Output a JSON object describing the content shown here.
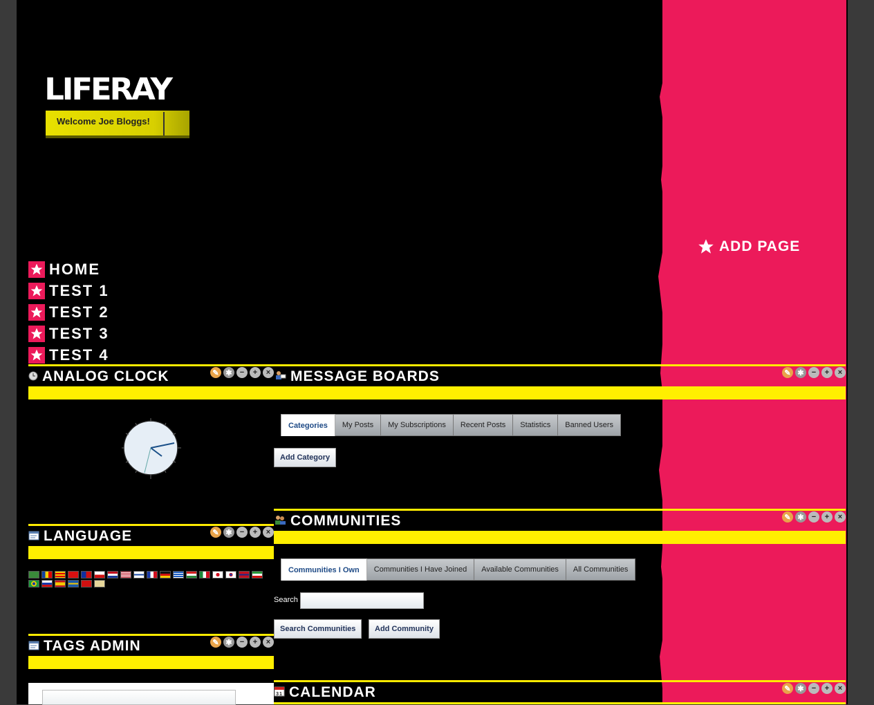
{
  "header": {
    "logo_text": "LIFERAY",
    "welcome_text": "Welcome Joe Bloggs!",
    "add_page_label": "ADD PAGE"
  },
  "colors": {
    "background": "#000000",
    "accent_pink": "#ec1a5a",
    "accent_yellow": "#ffef00",
    "outer_frame": "#3a3a3a"
  },
  "navigation": {
    "items": [
      {
        "label": "HOME",
        "icon": "star-icon"
      },
      {
        "label": "TEST 1",
        "icon": "star-icon"
      },
      {
        "label": "TEST 2",
        "icon": "star-icon"
      },
      {
        "label": "TEST 3",
        "icon": "star-icon"
      },
      {
        "label": "TEST 4",
        "icon": "star-icon"
      }
    ]
  },
  "portlets": {
    "analog_clock": {
      "title": "ANALOG CLOCK",
      "icon": "clock-icon"
    },
    "language": {
      "title": "LANGUAGE",
      "icon": "window-icon",
      "flags": [
        "ar",
        "ca-ad",
        "ca",
        "zh-cn",
        "zh-tw",
        "cs",
        "nl",
        "en-us",
        "fi",
        "fr",
        "de",
        "el",
        "hu",
        "it",
        "ja",
        "ko",
        "nb",
        "fa",
        "pt-br",
        "ru",
        "es",
        "sv",
        "tr",
        "vi"
      ]
    },
    "tags_admin": {
      "title": "TAGS ADMIN",
      "icon": "window-icon"
    },
    "message_boards": {
      "title": "MESSAGE BOARDS",
      "icon": "message-boards-icon",
      "tabs": [
        "Categories",
        "My Posts",
        "My Subscriptions",
        "Recent Posts",
        "Statistics",
        "Banned Users"
      ],
      "active_tab": "Categories",
      "add_category_label": "Add Category"
    },
    "communities": {
      "title": "COMMUNITIES",
      "icon": "communities-icon",
      "tabs": [
        "Communities I Own",
        "Communities I Have Joined",
        "Available Communities",
        "All Communities"
      ],
      "active_tab": "Communities I Own",
      "search_label": "Search",
      "search_value": "",
      "search_button": "Search Communities",
      "add_button": "Add Community"
    },
    "calendar": {
      "title": "CALENDAR",
      "icon": "calendar-icon"
    }
  },
  "portlet_controls": [
    "look-and-feel-icon",
    "configuration-gear-icon",
    "minimize-icon",
    "maximize-icon",
    "close-icon"
  ]
}
